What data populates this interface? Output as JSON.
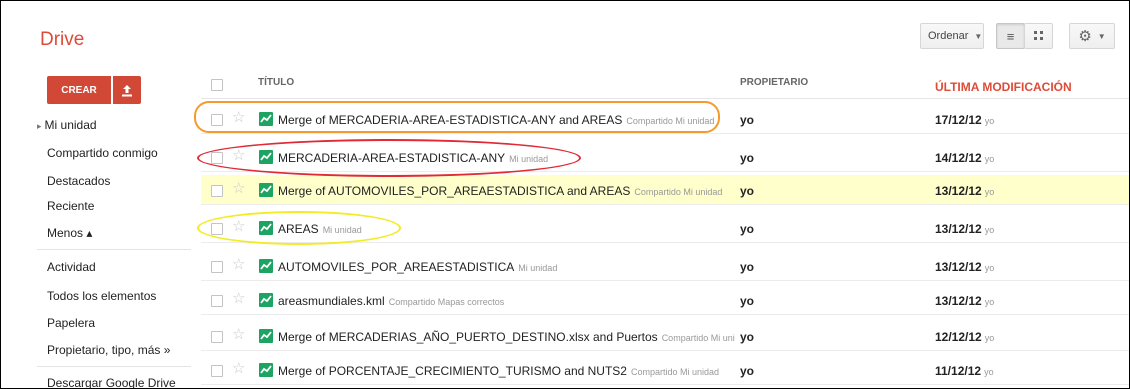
{
  "app": {
    "title": "Drive",
    "brand_color": "#dd4b39"
  },
  "toolbar": {
    "sort_label": "Ordenar"
  },
  "create": {
    "label": "CREAR"
  },
  "nav": {
    "items": [
      {
        "label": "Mi unidad",
        "prefix": "▸"
      },
      {
        "label": "Compartido conmigo"
      },
      {
        "label": "Destacados"
      },
      {
        "label": "Reciente"
      },
      {
        "label": "Menos ▴"
      },
      {
        "label": "Actividad"
      },
      {
        "label": "Todos los elementos"
      },
      {
        "label": "Papelera"
      },
      {
        "label": "Propietario, tipo, más »"
      },
      {
        "label": "Descargar Google Drive"
      }
    ]
  },
  "table": {
    "headers": {
      "title": "TÍTULO",
      "owner": "PROPIETARIO",
      "modified": "ÚLTIMA MODIFICACIÓN"
    },
    "rows": [
      {
        "name": "Merge of MERCADERIA-AREA-ESTADISTICA-ANY and AREAS",
        "tags": "Compartido  Mi unidad",
        "owner": "yo",
        "date": "17/12/12",
        "who": "yo"
      },
      {
        "name": "MERCADERIA-AREA-ESTADISTICA-ANY",
        "tags": "Mi unidad",
        "owner": "yo",
        "date": "14/12/12",
        "who": "yo"
      },
      {
        "name": "Merge of AUTOMOVILES_POR_AREAESTADISTICA and AREAS",
        "tags": "Compartido  Mi unidad",
        "owner": "yo",
        "date": "13/12/12",
        "who": "yo"
      },
      {
        "name": "AREAS",
        "tags": "Mi unidad",
        "owner": "yo",
        "date": "13/12/12",
        "who": "yo"
      },
      {
        "name": "AUTOMOVILES_POR_AREAESTADISTICA",
        "tags": "Mi unidad",
        "owner": "yo",
        "date": "13/12/12",
        "who": "yo"
      },
      {
        "name": "areasmundiales.kml",
        "tags": "Compartido  Mapas correctos",
        "owner": "yo",
        "date": "13/12/12",
        "who": "yo"
      },
      {
        "name": "Merge of MERCADERIAS_AÑO_PUERTO_DESTINO.xlsx and Puertos",
        "tags": "Compartido  Mi uni",
        "owner": "yo",
        "date": "12/12/12",
        "who": "yo"
      },
      {
        "name": "Merge of PORCENTAJE_CRECIMIENTO_TURISMO and NUTS2",
        "tags": "Compartido  Mi unidad",
        "owner": "yo",
        "date": "11/12/12",
        "who": "yo"
      }
    ]
  },
  "annotations": {
    "orange": "#f59b2d",
    "red": "#e02a35",
    "yellow": "#f2ec25"
  }
}
